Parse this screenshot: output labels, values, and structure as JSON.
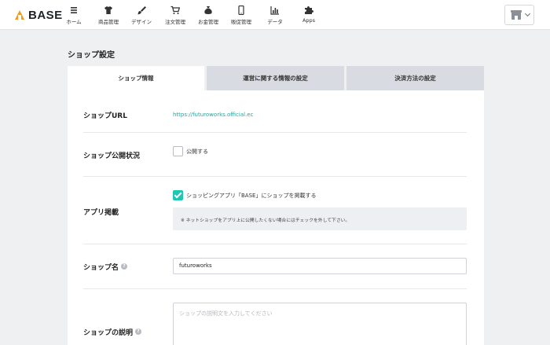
{
  "app": {
    "logo_text": "BASE"
  },
  "nav": [
    {
      "label": "ホーム",
      "icon": "menu-list-icon"
    },
    {
      "label": "商品管理",
      "icon": "shirt-icon"
    },
    {
      "label": "デザイン",
      "icon": "brush-icon"
    },
    {
      "label": "注文管理",
      "icon": "cart-icon"
    },
    {
      "label": "お金管理",
      "icon": "money-bag-icon"
    },
    {
      "label": "販促管理",
      "icon": "smartphone-icon"
    },
    {
      "label": "データ",
      "icon": "bar-chart-icon"
    },
    {
      "label": "Apps",
      "icon": "puzzle-icon"
    }
  ],
  "page": {
    "title": "ショップ設定"
  },
  "tabs": [
    {
      "label": "ショップ情報",
      "active": true
    },
    {
      "label": "運営に関する情報の設定",
      "active": false
    },
    {
      "label": "決済方法の設定",
      "active": false
    }
  ],
  "form": {
    "shop_url": {
      "label": "ショップURL",
      "value": "https://futuroworks.official.ec"
    },
    "visibility": {
      "label": "ショップ公開状況",
      "checkbox_label": "公開する",
      "checked": false
    },
    "app_listing": {
      "label": "アプリ掲載",
      "checkbox_label": "ショッピングアプリ「BASE」にショップを掲載する",
      "checked": true,
      "notice": "※ ネットショップをアプリ上に公開したくない場合にはチェックを外して下さい。"
    },
    "shop_name": {
      "label": "ショップ名",
      "value": "futuroworks"
    },
    "description": {
      "label": "ショップの説明",
      "placeholder": "ショップの説明文を入力してください"
    }
  },
  "colors": {
    "accent": "#1ec7b3",
    "link": "#26a59a",
    "logo": "#f29a1f"
  }
}
